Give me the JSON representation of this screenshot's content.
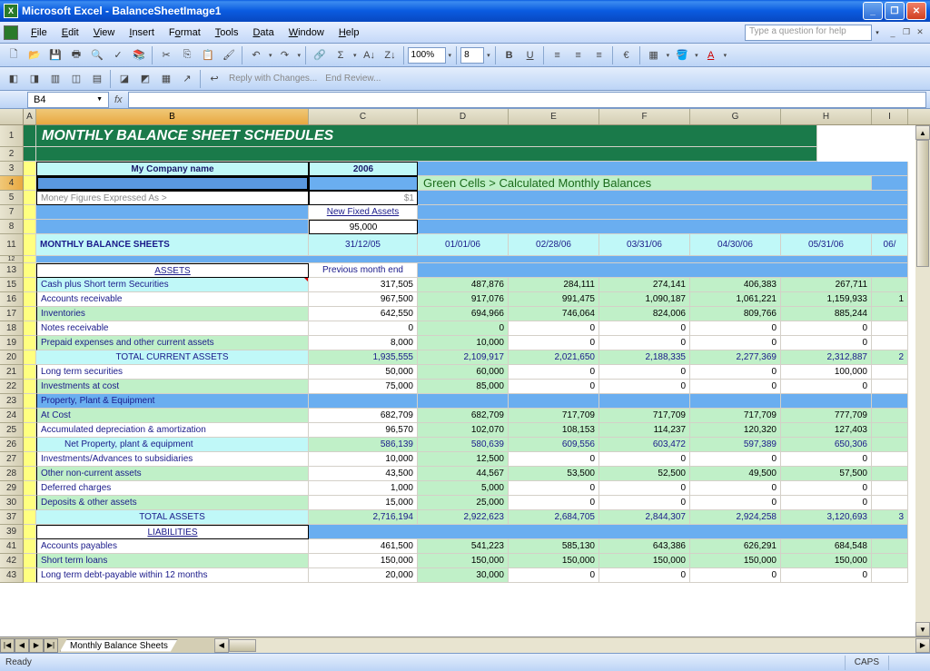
{
  "window": {
    "title": "Microsoft Excel - BalanceSheetImage1"
  },
  "menu": {
    "items": [
      "File",
      "Edit",
      "View",
      "Insert",
      "Format",
      "Tools",
      "Data",
      "Window",
      "Help"
    ],
    "help_placeholder": "Type a question for help"
  },
  "toolbar": {
    "zoom": "100%",
    "font_size": "8",
    "reply": "Reply with Changes...",
    "end_review": "End Review..."
  },
  "name_box": "B4",
  "sheet_title": "MONTHLY BALANCE SHEET SCHEDULES",
  "company_label": "My Company name",
  "year": "2006",
  "calc_note": "Green Cells > Calculated Monthly Balances",
  "money_label": "Money Figures Expressed As >",
  "money_val": "$1",
  "new_assets_label": "New Fixed Assets",
  "new_assets_val": "95,000",
  "section_title": "MONTHLY BALANCE SHEETS",
  "prev_month": "Previous month end",
  "dates": [
    "31/12/05",
    "01/01/06",
    "02/28/06",
    "03/31/06",
    "04/30/06",
    "05/31/06",
    "06/"
  ],
  "assets_label": "ASSETS",
  "liabilities_label": "LIABILITIES",
  "rows": {
    "r15": {
      "label": "Cash plus Short term Securities",
      "vals": [
        "317,505",
        "487,876",
        "284,111",
        "274,141",
        "406,383",
        "267,711",
        ""
      ]
    },
    "r16": {
      "label": "Accounts receivable",
      "vals": [
        "967,500",
        "917,076",
        "991,475",
        "1,090,187",
        "1,061,221",
        "1,159,933",
        "1"
      ]
    },
    "r17": {
      "label": "Inventories",
      "vals": [
        "642,550",
        "694,966",
        "746,064",
        "824,006",
        "809,766",
        "885,244",
        ""
      ]
    },
    "r18": {
      "label": "Notes receivable",
      "vals": [
        "0",
        "0",
        "0",
        "0",
        "0",
        "0",
        ""
      ]
    },
    "r19": {
      "label": "Prepaid expenses and other current assets",
      "vals": [
        "8,000",
        "10,000",
        "0",
        "0",
        "0",
        "0",
        ""
      ]
    },
    "r20": {
      "label": "TOTAL CURRENT ASSETS",
      "vals": [
        "1,935,555",
        "2,109,917",
        "2,021,650",
        "2,188,335",
        "2,277,369",
        "2,312,887",
        "2"
      ]
    },
    "r21": {
      "label": "Long term securities",
      "vals": [
        "50,000",
        "60,000",
        "0",
        "0",
        "0",
        "100,000",
        ""
      ]
    },
    "r22": {
      "label": "Investments at cost",
      "vals": [
        "75,000",
        "85,000",
        "0",
        "0",
        "0",
        "0",
        ""
      ]
    },
    "r23": {
      "label": "Property, Plant & Equipment",
      "vals": [
        "",
        "",
        "",
        "",
        "",
        "",
        ""
      ]
    },
    "r24": {
      "label": "At Cost",
      "vals": [
        "682,709",
        "682,709",
        "717,709",
        "717,709",
        "717,709",
        "777,709",
        ""
      ]
    },
    "r25": {
      "label": "Accumulated depreciation & amortization",
      "vals": [
        "96,570",
        "102,070",
        "108,153",
        "114,237",
        "120,320",
        "127,403",
        ""
      ]
    },
    "r26": {
      "label": "Net Property, plant & equipment",
      "vals": [
        "586,139",
        "580,639",
        "609,556",
        "603,472",
        "597,389",
        "650,306",
        ""
      ]
    },
    "r27": {
      "label": "Investments/Advances to subsidiaries",
      "vals": [
        "10,000",
        "12,500",
        "0",
        "0",
        "0",
        "0",
        ""
      ]
    },
    "r28": {
      "label": "Other non-current assets",
      "vals": [
        "43,500",
        "44,567",
        "53,500",
        "52,500",
        "49,500",
        "57,500",
        ""
      ]
    },
    "r29": {
      "label": "Deferred charges",
      "vals": [
        "1,000",
        "5,000",
        "0",
        "0",
        "0",
        "0",
        ""
      ]
    },
    "r30": {
      "label": "Deposits & other assets",
      "vals": [
        "15,000",
        "25,000",
        "0",
        "0",
        "0",
        "0",
        ""
      ]
    },
    "r37": {
      "label": "TOTAL ASSETS",
      "vals": [
        "2,716,194",
        "2,922,623",
        "2,684,705",
        "2,844,307",
        "2,924,258",
        "3,120,693",
        "3"
      ]
    },
    "r41": {
      "label": "Accounts payables",
      "vals": [
        "461,500",
        "541,223",
        "585,130",
        "643,386",
        "626,291",
        "684,548",
        ""
      ]
    },
    "r42": {
      "label": "Short term loans",
      "vals": [
        "150,000",
        "150,000",
        "150,000",
        "150,000",
        "150,000",
        "150,000",
        ""
      ]
    },
    "r43": {
      "label": "Long term debt-payable within 12 months",
      "vals": [
        "20,000",
        "30,000",
        "0",
        "0",
        "0",
        "0",
        ""
      ]
    }
  },
  "col_headers": [
    "A",
    "B",
    "C",
    "D",
    "E",
    "F",
    "G",
    "H",
    "I"
  ],
  "row_headers": [
    "1",
    "2",
    "3",
    "4",
    "5",
    "7",
    "8",
    "11",
    "12",
    "13",
    "15",
    "16",
    "17",
    "18",
    "19",
    "20",
    "21",
    "22",
    "23",
    "24",
    "25",
    "26",
    "27",
    "28",
    "29",
    "30",
    "37",
    "39",
    "41",
    "42",
    "43"
  ],
  "sheet_tab": "Monthly Balance Sheets",
  "status": {
    "ready": "Ready",
    "caps": "CAPS"
  }
}
